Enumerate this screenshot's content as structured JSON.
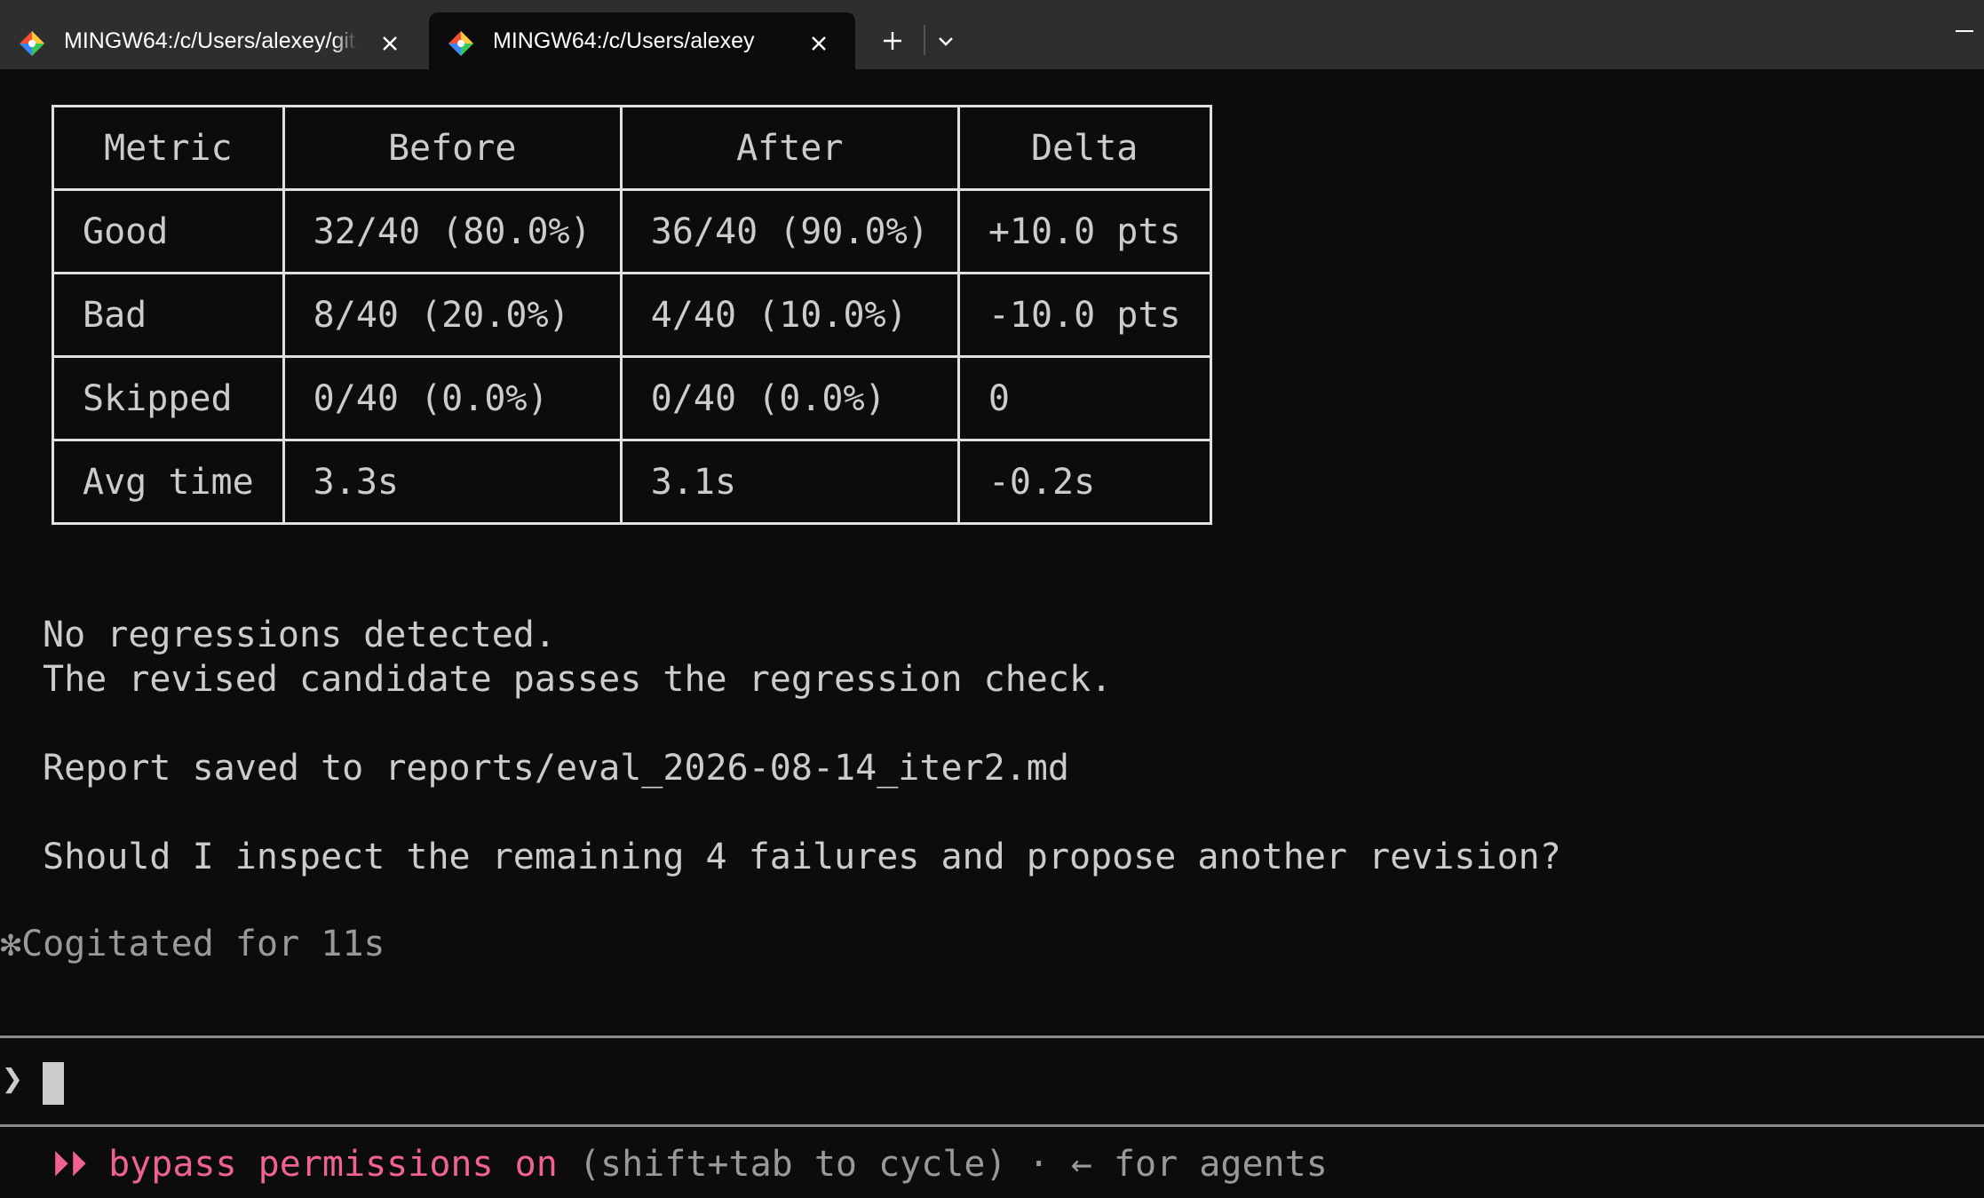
{
  "tabs": [
    {
      "title": "MINGW64:/c/Users/alexey/git/",
      "active": false,
      "icon": "git-bash-icon",
      "close_icon": "close-icon"
    },
    {
      "title": "MINGW64:/c/Users/alexey",
      "active": true,
      "icon": "git-bash-icon",
      "close_icon": "close-icon"
    }
  ],
  "tabbar": {
    "new_tab_icon": "plus-icon",
    "dropdown_icon": "chevron-down-icon",
    "minimize_icon": "minimize-icon"
  },
  "table": {
    "headers": [
      "Metric",
      "Before",
      "After",
      "Delta"
    ],
    "rows": [
      [
        "Good",
        "32/40 (80.0%)",
        "36/40 (90.0%)",
        "+10.0 pts"
      ],
      [
        "Bad",
        "8/40 (20.0%)",
        "4/40 (10.0%)",
        "-10.0 pts"
      ],
      [
        "Skipped",
        "0/40 (0.0%)",
        "0/40 (0.0%)",
        "0"
      ],
      [
        "Avg time",
        "3.3s",
        "3.1s",
        "-0.2s"
      ]
    ]
  },
  "output": {
    "line1": "No regressions detected.",
    "line2": "The revised candidate passes the regression check.",
    "line3": "Report saved to reports/eval_2026-08-14_iter2.md",
    "line4": "Should I inspect the remaining 4 failures and propose another revision?"
  },
  "status": {
    "spinner": "✻",
    "text": "Cogitated for 11s"
  },
  "prompt": {
    "caret": "❯",
    "value": ""
  },
  "footer": {
    "arrows": "⏵⏵",
    "mode": "bypass permissions on",
    "hint": "(shift+tab to cycle) · ← for agents"
  },
  "colors": {
    "background": "#0c0c0c",
    "tabbar": "#2e2e2e",
    "text": "#cccccc",
    "dim": "#999999",
    "accent_pink": "#f06292"
  }
}
